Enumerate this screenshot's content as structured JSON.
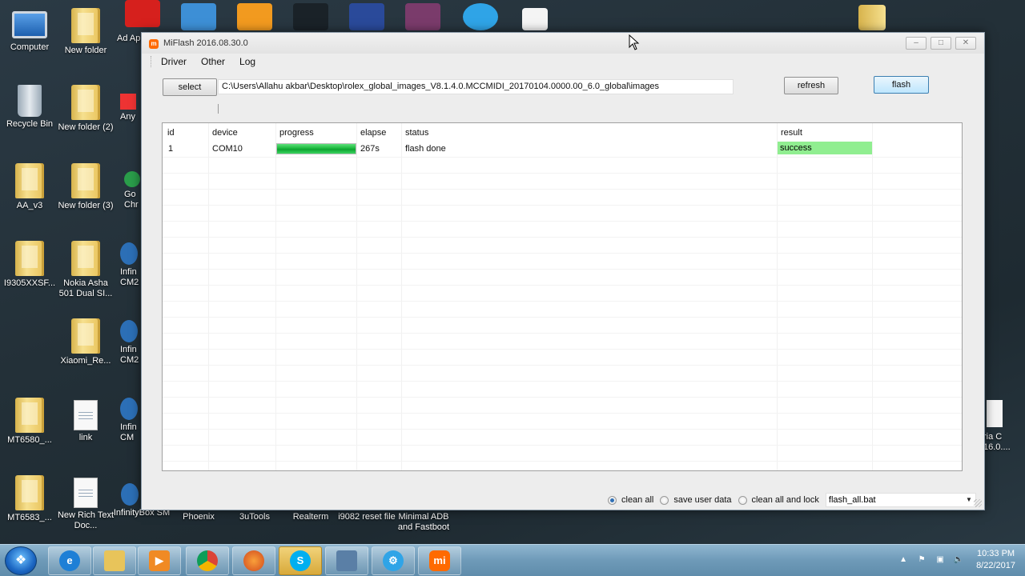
{
  "desktop": {
    "left_column": [
      {
        "label": "Computer"
      },
      {
        "label": "Recycle Bin"
      },
      {
        "label": "AA_v3"
      },
      {
        "label": "I9305XXSF..."
      },
      {
        "label": "MT6580_..."
      },
      {
        "label": "MT6583_..."
      }
    ],
    "second_column": [
      {
        "label": "New folder"
      },
      {
        "label": "New folder (2)"
      },
      {
        "label": "New folder (3)"
      },
      {
        "label": "Nokia Asha 501 Dual SI..."
      },
      {
        "label": "Xiaomi_Re..."
      },
      {
        "label": "link"
      },
      {
        "label": "New Rich Text Doc..."
      }
    ],
    "third_column": [
      {
        "label": "Ad Appl"
      },
      {
        "label": "Any"
      },
      {
        "label": "Go Chr"
      },
      {
        "label": "Infin CM2"
      },
      {
        "label": "Infin CM2"
      },
      {
        "label": "Infin CM"
      },
      {
        "label": "InfinityBox SM"
      }
    ],
    "bottom_row": [
      {
        "label": "Phoenix"
      },
      {
        "label": "3uTools"
      },
      {
        "label": "Realterm"
      },
      {
        "label": "i9082 reset file"
      },
      {
        "label": "Minimal ADB and Fastboot"
      }
    ],
    "right_partial": {
      "label": "ria C 16.0...."
    }
  },
  "window": {
    "title": "MiFlash 2016.08.30.0",
    "menu": [
      "Driver",
      "Other",
      "Log"
    ],
    "select_label": "select",
    "path_value": "C:\\Users\\Allahu akbar\\Desktop\\rolex_global_images_V8.1.4.0.MCCMIDI_20170104.0000.00_6.0_global\\images",
    "refresh_label": "refresh",
    "flash_label": "flash"
  },
  "table": {
    "columns": [
      "id",
      "device",
      "progress",
      "elapse",
      "status",
      "result"
    ],
    "rows": [
      {
        "id": "1",
        "device": "COM10",
        "progress": 1.0,
        "elapse": "267s",
        "status": "flash done",
        "result": "success"
      }
    ]
  },
  "options": {
    "radios": [
      {
        "label": "clean all",
        "checked": true
      },
      {
        "label": "save user data",
        "checked": false
      },
      {
        "label": "clean all and lock",
        "checked": false
      }
    ],
    "script_selected": "flash_all.bat"
  },
  "taskbar": {
    "time": "10:33 PM",
    "date": "8/22/2017"
  },
  "colors": {
    "success": "#90ee90",
    "progress": "#1cb83e",
    "taskbar": "#6e9ab8"
  }
}
